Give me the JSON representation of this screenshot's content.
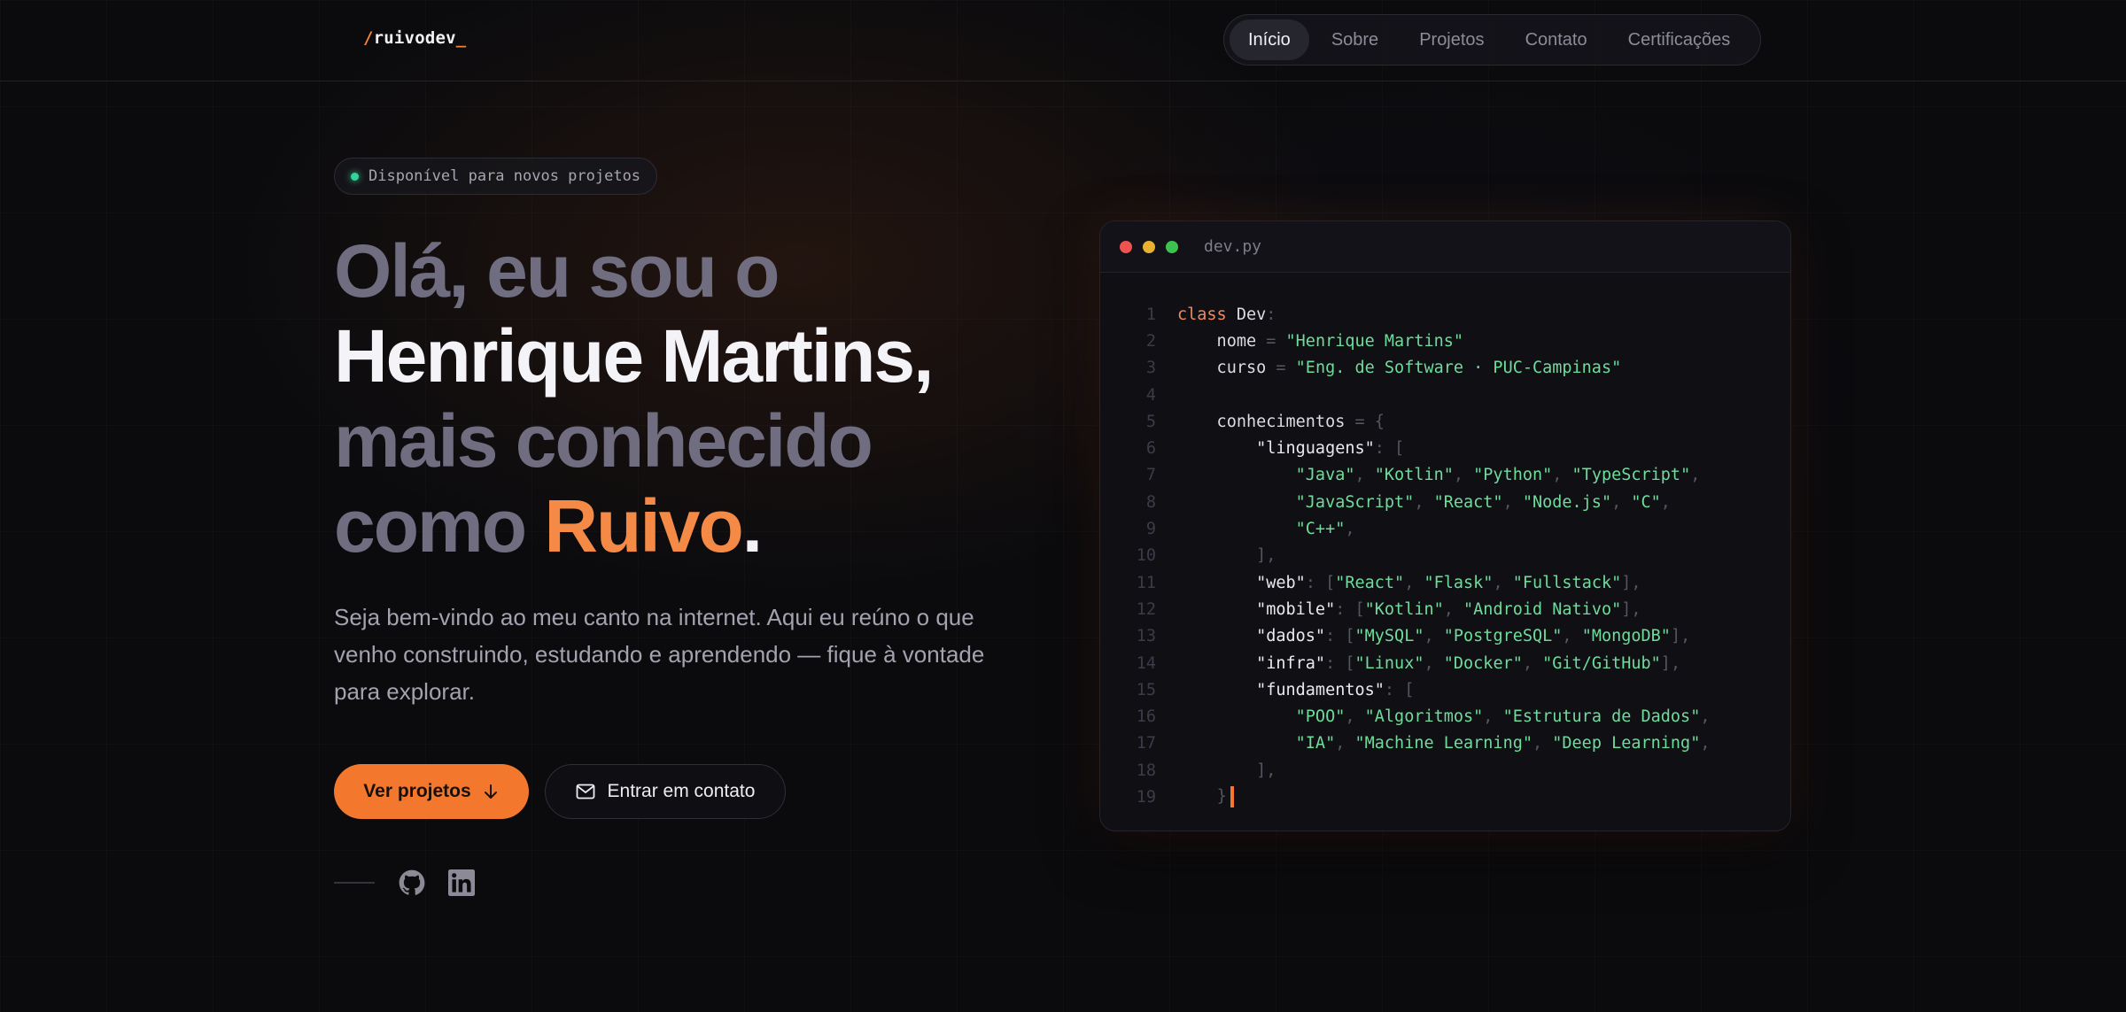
{
  "header": {
    "logo_slash": "/",
    "logo_text": "ruivodev",
    "logo_cursor": "_",
    "nav": [
      "Início",
      "Sobre",
      "Projetos",
      "Contato",
      "Certificações"
    ],
    "active_nav": "Início"
  },
  "hero": {
    "badge": "Disponível para novos projetos",
    "title_line1": "Olá, eu sou o",
    "title_name": "Henrique Martins,",
    "title_line3": "mais conhecido",
    "title_line4_prefix": "como ",
    "title_nick": "Ruivo",
    "title_end": ".",
    "description": "Seja bem-vindo ao meu canto na internet. Aqui eu reúno o que venho construindo, estudando e aprendendo — fique à vontade para explorar.",
    "primary_button": "Ver projetos",
    "secondary_button": "Entrar em contato",
    "social_icons": [
      "github-icon",
      "linkedin-icon"
    ]
  },
  "code_window": {
    "filename": "dev.py",
    "line_numbers": [
      "1",
      "2",
      "3",
      "4",
      "5",
      "6",
      "7",
      "8",
      "9",
      "10",
      "11",
      "12",
      "13",
      "14",
      "15",
      "16",
      "17",
      "18",
      "19"
    ],
    "lines": [
      "class Dev:",
      "    nome = \"Henrique Martins\"",
      "    curso = \"Eng. de Software · PUC-Campinas\"",
      "",
      "    conhecimentos = {",
      "        \"linguagens\": [",
      "            \"Java\", \"Kotlin\", \"Python\", \"TypeScript\",",
      "            \"JavaScript\", \"React\", \"Node.js\", \"C\",",
      "            \"C++\",",
      "        ],",
      "        \"web\": [\"React\", \"Flask\", \"Fullstack\"],",
      "        \"mobile\": [\"Kotlin\", \"Android Nativo\"],",
      "        \"dados\": [\"MySQL\", \"PostgreSQL\", \"MongoDB\"],",
      "        \"infra\": [\"Linux\", \"Docker\", \"Git/GitHub\"],",
      "        \"fundamentos\": [",
      "            \"POO\", \"Algoritmos\", \"Estrutura de Dados\",",
      "            \"IA\", \"Machine Learning\", \"Deep Learning\",",
      "        ],",
      "    }"
    ]
  },
  "colors": {
    "accent": "#f3782d",
    "background": "#0b0b0e",
    "string": "#6fdc9c",
    "keyword": "#f08a5d",
    "status_dot": "#34d399"
  }
}
